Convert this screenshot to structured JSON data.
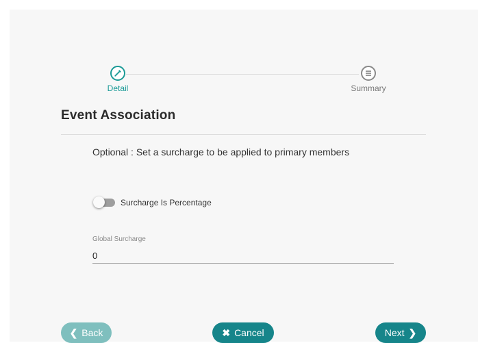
{
  "stepper": {
    "steps": [
      {
        "label": "Detail",
        "icon": "pencil-icon",
        "state": "active"
      },
      {
        "label": "Summary",
        "icon": "list-icon",
        "state": "inactive"
      }
    ]
  },
  "section": {
    "title": "Event Association",
    "help_text": "Optional : Set a surcharge to be applied to primary members"
  },
  "toggle": {
    "label": "Surcharge Is Percentage",
    "checked": false
  },
  "global_surcharge": {
    "label": "Global Surcharge",
    "value": "0"
  },
  "buttons": {
    "back": "Back",
    "cancel": "Cancel",
    "next": "Next"
  },
  "colors": {
    "accent": "#16858a",
    "accent_light": "#7fbfbe",
    "active_step": "#1a9a96"
  }
}
